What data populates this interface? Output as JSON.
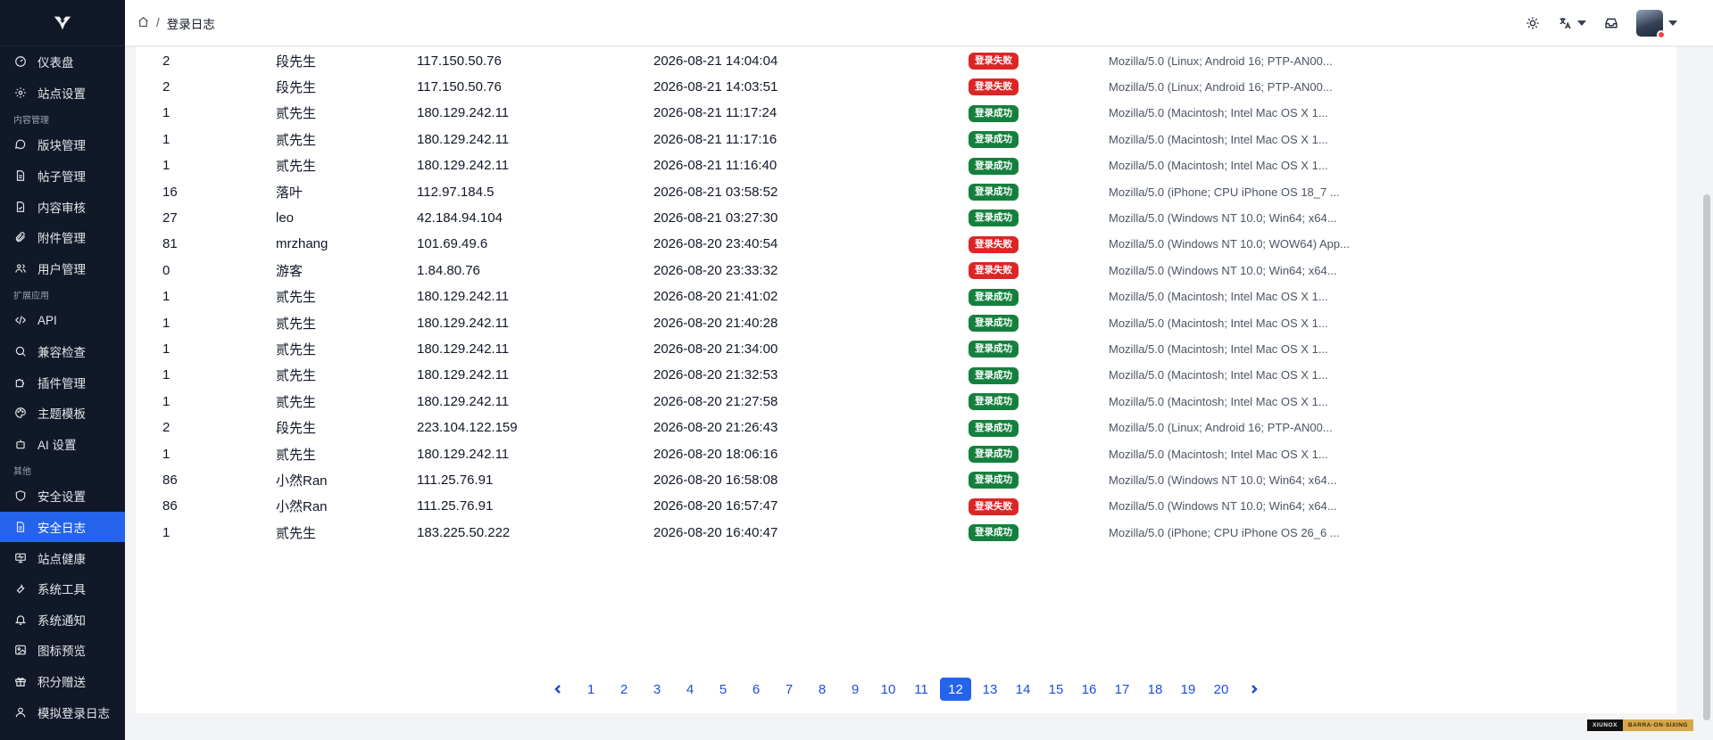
{
  "breadcrumb": {
    "current": "登录日志"
  },
  "sidebar": {
    "groups": [
      {
        "title": "",
        "items": [
          {
            "label": "仪表盘",
            "icon": "dashboard-icon"
          },
          {
            "label": "站点设置",
            "icon": "gear-icon"
          }
        ]
      },
      {
        "title": "内容管理",
        "items": [
          {
            "label": "版块管理",
            "icon": "chat-bubble-icon"
          },
          {
            "label": "帖子管理",
            "icon": "document-icon"
          },
          {
            "label": "内容审核",
            "icon": "document-check-icon"
          },
          {
            "label": "附件管理",
            "icon": "paperclip-icon"
          },
          {
            "label": "用户管理",
            "icon": "users-icon"
          }
        ]
      },
      {
        "title": "扩展应用",
        "items": [
          {
            "label": "API",
            "icon": "code-icon"
          },
          {
            "label": "兼容检查",
            "icon": "search-icon"
          },
          {
            "label": "插件管理",
            "icon": "puzzle-icon"
          },
          {
            "label": "主题模板",
            "icon": "palette-icon"
          },
          {
            "label": "AI 设置",
            "icon": "bot-icon"
          }
        ]
      },
      {
        "title": "其他",
        "items": [
          {
            "label": "安全设置",
            "icon": "shield-icon"
          },
          {
            "label": "安全日志",
            "icon": "document-icon",
            "active": true
          },
          {
            "label": "站点健康",
            "icon": "monitor-icon"
          },
          {
            "label": "系统工具",
            "icon": "wrench-icon"
          },
          {
            "label": "系统通知",
            "icon": "bell-icon"
          },
          {
            "label": "图标预览",
            "icon": "image-icon"
          },
          {
            "label": "积分赠送",
            "icon": "gift-icon"
          },
          {
            "label": "模拟登录日志",
            "icon": "user-icon"
          }
        ]
      }
    ]
  },
  "status_labels": {
    "ok": "登录成功",
    "fail": "登录失败"
  },
  "rows": [
    {
      "uid": "2",
      "name": "段先生",
      "ip": "117.150.50.76",
      "time": "2026-08-21 14:04:04",
      "status": "fail",
      "ua": "Mozilla/5.0 (Linux; Android 16; PTP-AN00..."
    },
    {
      "uid": "2",
      "name": "段先生",
      "ip": "117.150.50.76",
      "time": "2026-08-21 14:03:51",
      "status": "fail",
      "ua": "Mozilla/5.0 (Linux; Android 16; PTP-AN00..."
    },
    {
      "uid": "1",
      "name": "贰先生",
      "ip": "180.129.242.11",
      "time": "2026-08-21 11:17:24",
      "status": "ok",
      "ua": "Mozilla/5.0 (Macintosh; Intel Mac OS X 1..."
    },
    {
      "uid": "1",
      "name": "贰先生",
      "ip": "180.129.242.11",
      "time": "2026-08-21 11:17:16",
      "status": "ok",
      "ua": "Mozilla/5.0 (Macintosh; Intel Mac OS X 1..."
    },
    {
      "uid": "1",
      "name": "贰先生",
      "ip": "180.129.242.11",
      "time": "2026-08-21 11:16:40",
      "status": "ok",
      "ua": "Mozilla/5.0 (Macintosh; Intel Mac OS X 1..."
    },
    {
      "uid": "16",
      "name": "落叶",
      "ip": "112.97.184.5",
      "time": "2026-08-21 03:58:52",
      "status": "ok",
      "ua": "Mozilla/5.0 (iPhone; CPU iPhone OS 18_7 ..."
    },
    {
      "uid": "27",
      "name": "leo",
      "ip": "42.184.94.104",
      "time": "2026-08-21 03:27:30",
      "status": "ok",
      "ua": "Mozilla/5.0 (Windows NT 10.0; Win64; x64..."
    },
    {
      "uid": "81",
      "name": "mrzhang",
      "ip": "101.69.49.6",
      "time": "2026-08-20 23:40:54",
      "status": "fail",
      "ua": "Mozilla/5.0 (Windows NT 10.0; WOW64) App..."
    },
    {
      "uid": "0",
      "name": "游客",
      "ip": "1.84.80.76",
      "time": "2026-08-20 23:33:32",
      "status": "fail",
      "ua": "Mozilla/5.0 (Windows NT 10.0; Win64; x64..."
    },
    {
      "uid": "1",
      "name": "贰先生",
      "ip": "180.129.242.11",
      "time": "2026-08-20 21:41:02",
      "status": "ok",
      "ua": "Mozilla/5.0 (Macintosh; Intel Mac OS X 1..."
    },
    {
      "uid": "1",
      "name": "贰先生",
      "ip": "180.129.242.11",
      "time": "2026-08-20 21:40:28",
      "status": "ok",
      "ua": "Mozilla/5.0 (Macintosh; Intel Mac OS X 1..."
    },
    {
      "uid": "1",
      "name": "贰先生",
      "ip": "180.129.242.11",
      "time": "2026-08-20 21:34:00",
      "status": "ok",
      "ua": "Mozilla/5.0 (Macintosh; Intel Mac OS X 1..."
    },
    {
      "uid": "1",
      "name": "贰先生",
      "ip": "180.129.242.11",
      "time": "2026-08-20 21:32:53",
      "status": "ok",
      "ua": "Mozilla/5.0 (Macintosh; Intel Mac OS X 1..."
    },
    {
      "uid": "1",
      "name": "贰先生",
      "ip": "180.129.242.11",
      "time": "2026-08-20 21:27:58",
      "status": "ok",
      "ua": "Mozilla/5.0 (Macintosh; Intel Mac OS X 1..."
    },
    {
      "uid": "2",
      "name": "段先生",
      "ip": "223.104.122.159",
      "time": "2026-08-20 21:26:43",
      "status": "ok",
      "ua": "Mozilla/5.0 (Linux; Android 16; PTP-AN00..."
    },
    {
      "uid": "1",
      "name": "贰先生",
      "ip": "180.129.242.11",
      "time": "2026-08-20 18:06:16",
      "status": "ok",
      "ua": "Mozilla/5.0 (Macintosh; Intel Mac OS X 1..."
    },
    {
      "uid": "86",
      "name": "小然Ran",
      "ip": "111.25.76.91",
      "time": "2026-08-20 16:58:08",
      "status": "ok",
      "ua": "Mozilla/5.0 (Windows NT 10.0; Win64; x64..."
    },
    {
      "uid": "86",
      "name": "小然Ran",
      "ip": "111.25.76.91",
      "time": "2026-08-20 16:57:47",
      "status": "fail",
      "ua": "Mozilla/5.0 (Windows NT 10.0; Win64; x64..."
    },
    {
      "uid": "1",
      "name": "贰先生",
      "ip": "183.225.50.222",
      "time": "2026-08-20 16:40:47",
      "status": "ok",
      "ua": "Mozilla/5.0 (iPhone; CPU iPhone OS 26_6 ..."
    }
  ],
  "pagination": {
    "pages": [
      "1",
      "2",
      "3",
      "4",
      "5",
      "6",
      "7",
      "8",
      "9",
      "10",
      "11",
      "12",
      "13",
      "14",
      "15",
      "16",
      "17",
      "18",
      "19",
      "20"
    ],
    "current": "12"
  },
  "brand": {
    "left": "XIUNOX",
    "right": "BARRA·ON·SIXING"
  },
  "colors": {
    "sidebar_bg": "#111827",
    "accent": "#2563eb",
    "success": "#15803d",
    "danger": "#dc2626"
  }
}
